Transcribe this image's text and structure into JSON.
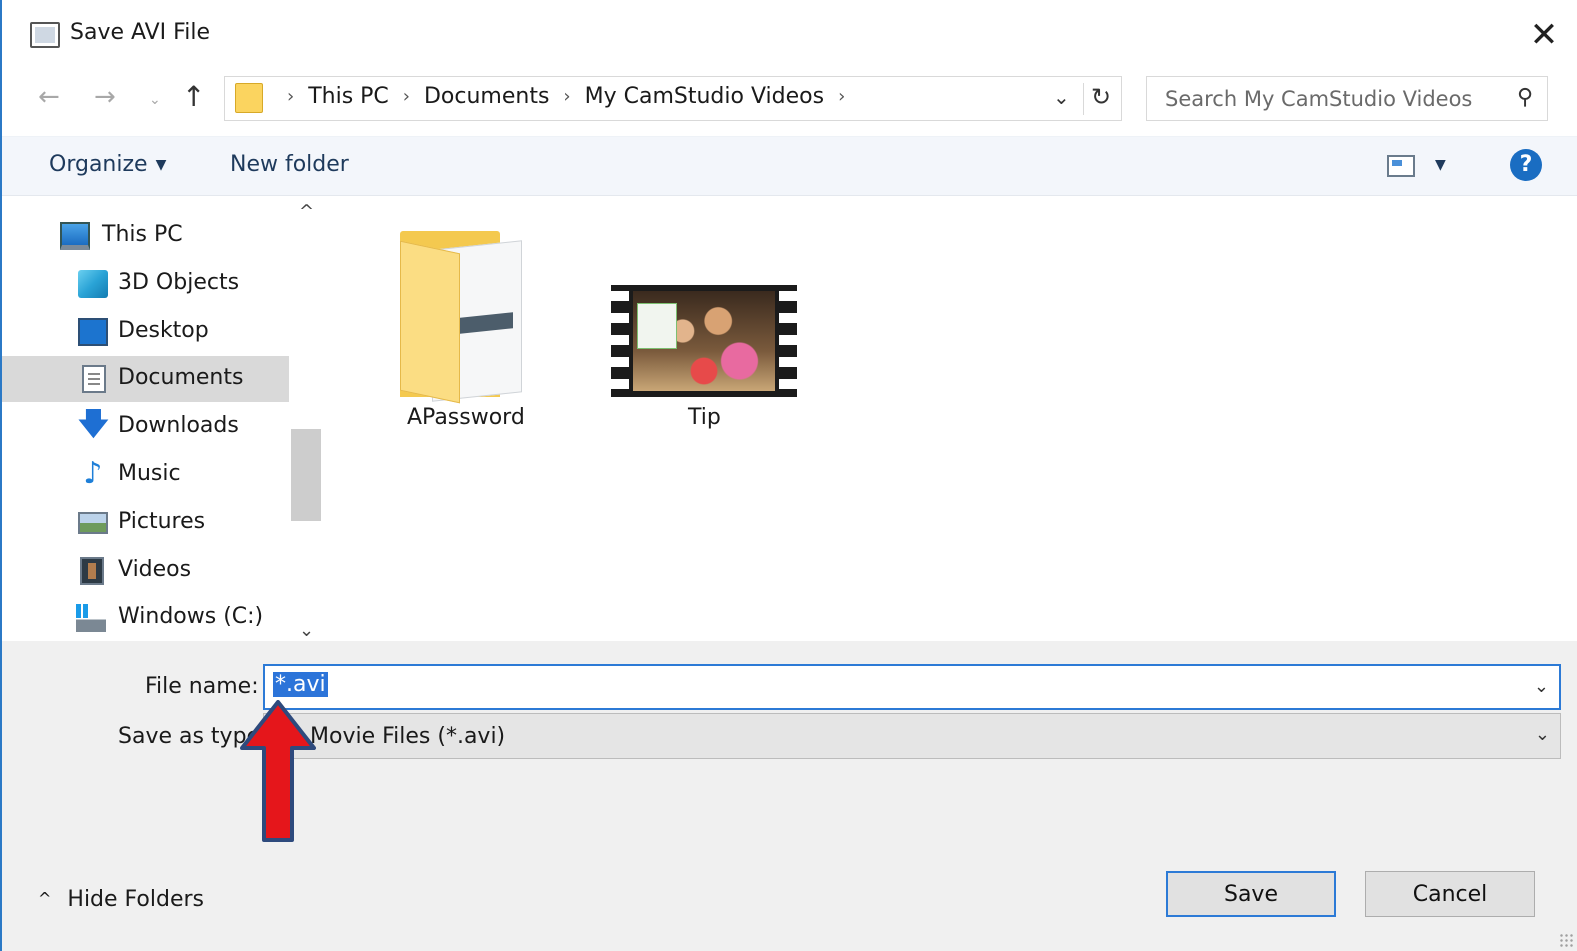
{
  "window": {
    "title": "Save AVI File",
    "close_glyph": "✕"
  },
  "address": {
    "back_glyph": "←",
    "forward_glyph": "→",
    "recent_glyph": "⌄",
    "up_glyph": "↑",
    "crumbs": [
      "This PC",
      "Documents",
      "My CamStudio Videos"
    ],
    "separator": "›",
    "dropdown_glyph": "⌄",
    "refresh_glyph": "↻"
  },
  "search": {
    "placeholder": "Search My CamStudio Videos",
    "icon_glyph": "⚲"
  },
  "toolbar": {
    "organize_label": "Organize",
    "organize_caret": "▼",
    "new_folder_label": "New folder",
    "view_caret": "▼",
    "help_glyph": "?"
  },
  "nav_pane": {
    "items": [
      {
        "label": "This PC",
        "icon": "this-pc-icon"
      },
      {
        "label": "3D Objects",
        "icon": "3d-objects-icon"
      },
      {
        "label": "Desktop",
        "icon": "desktop-icon"
      },
      {
        "label": "Documents",
        "icon": "documents-icon",
        "selected": true
      },
      {
        "label": "Downloads",
        "icon": "downloads-icon"
      },
      {
        "label": "Music",
        "icon": "music-icon"
      },
      {
        "label": "Pictures",
        "icon": "pictures-icon"
      },
      {
        "label": "Videos",
        "icon": "videos-icon"
      },
      {
        "label": "Windows (C:)",
        "icon": "drive-icon"
      }
    ],
    "scroll_up_glyph": "^",
    "scroll_down_glyph": "⌄",
    "down_arrow_glyph": "🡇",
    "music_glyph": "♪"
  },
  "files": [
    {
      "name": "APassword",
      "type": "folder"
    },
    {
      "name": "Tip",
      "type": "video"
    }
  ],
  "form": {
    "file_name_label": "File name:",
    "file_name_value": "*.avi",
    "save_as_type_label": "Save as type:",
    "save_as_type_value": "Movie Files (*.avi)",
    "caret_glyph": "⌄"
  },
  "footer": {
    "hide_folders_label": "Hide Folders",
    "hide_folders_glyph": "^",
    "save_label": "Save",
    "cancel_label": "Cancel"
  },
  "colors": {
    "accent": "#2c7ad6",
    "help_blue": "#1a6dc2",
    "annotation_arrow": "#e5161b",
    "annotation_outline": "#2e4a7d"
  }
}
